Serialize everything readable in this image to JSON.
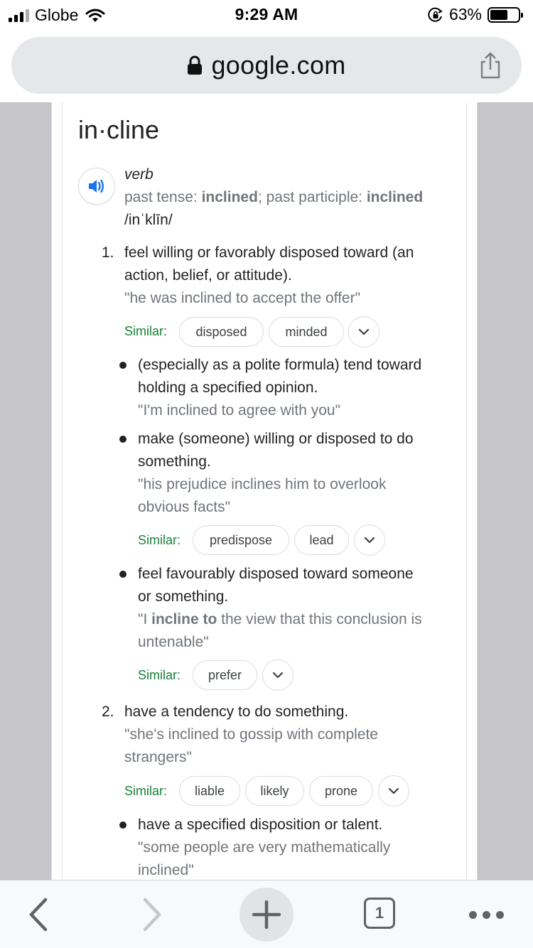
{
  "status": {
    "carrier": "Globe",
    "time": "9:29 AM",
    "battery": "63%",
    "battery_level": 0.63
  },
  "browser": {
    "url": "google.com"
  },
  "entry": {
    "headword": "in·cline",
    "part_of_speech": "verb",
    "tense_prefix": "past tense: ",
    "past_tense": "inclined",
    "participle_prefix": "; past participle: ",
    "past_participle": "inclined",
    "phonetic": "/inˈklīn/",
    "similar_label": "Similar:",
    "senses": [
      {
        "number": "1.",
        "lines": [
          "feel willing or favorably disposed toward (an",
          "action, belief, or attitude)."
        ],
        "example": "\"he was inclined to accept the offer\"",
        "similar": [
          "disposed",
          "minded"
        ],
        "subsenses": [
          {
            "lines": [
              "(especially as a polite formula) tend toward",
              "holding a specified opinion."
            ],
            "example": "\"I'm inclined to agree with you\""
          },
          {
            "lines": [
              "make (someone) willing or disposed to do",
              "something."
            ],
            "example_lines": [
              "\"his prejudice inclines him to overlook",
              "obvious facts\""
            ],
            "similar": [
              "predispose",
              "lead"
            ]
          },
          {
            "lines": [
              "feel favourably disposed toward someone",
              "or something."
            ],
            "example_parts": [
              "\"I ",
              "incline to",
              " the view that this conclusion is"
            ],
            "example_line2": "untenable\"",
            "similar": [
              "prefer"
            ]
          }
        ]
      },
      {
        "number": "2.",
        "lines": [
          "have a tendency to do something."
        ],
        "example_lines": [
          "\"she's inclined to gossip with complete",
          "strangers\""
        ],
        "similar": [
          "liable",
          "likely",
          "prone"
        ],
        "subsenses": [
          {
            "lines": [
              "have a specified disposition or talent."
            ],
            "example_lines": [
              "\"some people are very mathematically",
              "inclined\""
            ]
          }
        ]
      }
    ]
  },
  "toolbar": {
    "tab_count": "1"
  }
}
